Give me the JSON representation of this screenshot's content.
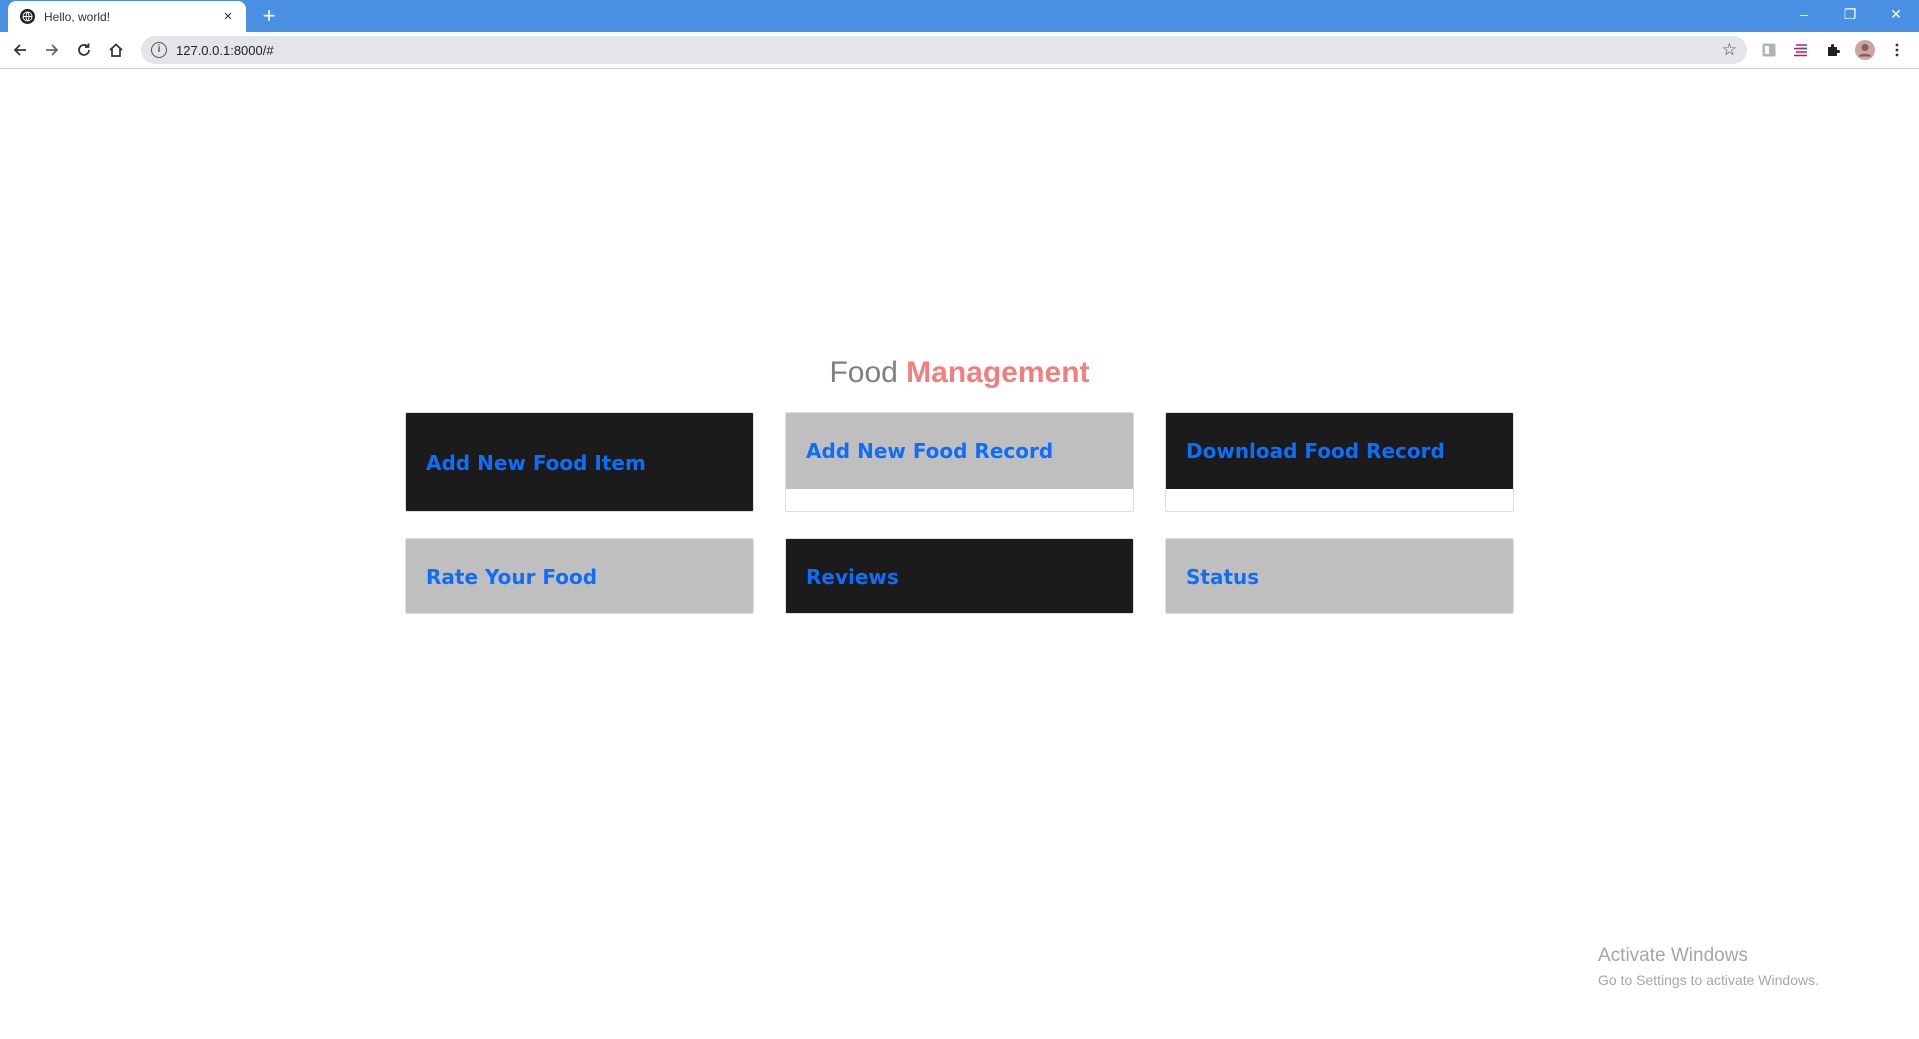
{
  "browser": {
    "tab_title": "Hello, world!",
    "tab_close": "×",
    "new_tab": "+",
    "url": "127.0.0.1:8000/#",
    "window_controls": {
      "minimize": "–",
      "restore": "❐",
      "close": "✕"
    }
  },
  "page": {
    "title_light": "Food",
    "title_bold": "Management",
    "cards": [
      {
        "label": "Add New Food Item",
        "theme": "dark"
      },
      {
        "label": "Add New Food Record",
        "theme": "grey"
      },
      {
        "label": "Download Food Record",
        "theme": "dark"
      },
      {
        "label": "Rate Your Food",
        "theme": "grey"
      },
      {
        "label": "Reviews",
        "theme": "dark"
      },
      {
        "label": "Status",
        "theme": "grey"
      }
    ]
  },
  "watermark": {
    "title": "Activate Windows",
    "subtitle": "Go to Settings to activate Windows."
  },
  "colors": {
    "tab_strip": "#4a90e2",
    "card_dark": "#1b1b1b",
    "card_grey": "#bfbfbf",
    "link_blue": "#0d6efd",
    "title_grey": "#808080",
    "title_pink": "#f08080"
  }
}
